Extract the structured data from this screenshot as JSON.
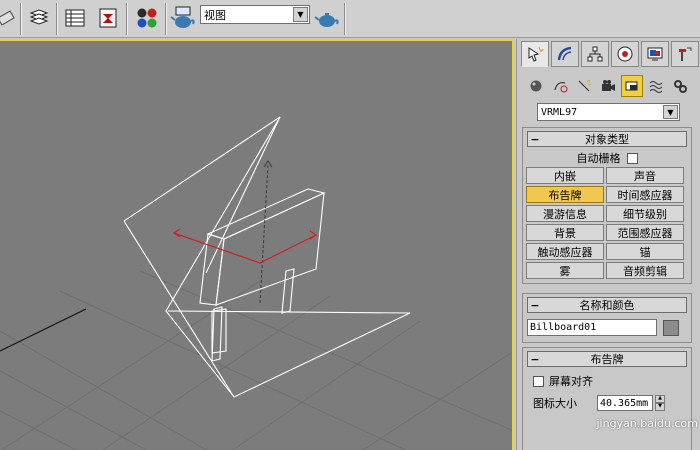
{
  "toolbar": {
    "view_dropdown_value": "视图",
    "icons": [
      "eraser-icon",
      "layers-icon",
      "table-icon",
      "curve-editor-icon",
      "material-editor-icon",
      "render-scene-icon",
      "quick-render-icon",
      "teapot-render-icon"
    ]
  },
  "command_panel": {
    "tabs": [
      "create-tab",
      "modify-tab",
      "hierarchy-tab",
      "motion-tab",
      "display-tab",
      "utilities-tab"
    ],
    "subcategory_dropdown": "VRML97",
    "object_type": {
      "title": "对象类型",
      "auto_grid_label": "自动栅格",
      "buttons": [
        "内嵌",
        "声音",
        "布告牌",
        "时间感应器",
        "漫游信息",
        "细节级别",
        "背景",
        "范围感应器",
        "触动感应器",
        "锚",
        "雾",
        "音频剪辑"
      ],
      "active_button": "布告牌"
    },
    "name_color": {
      "title": "名称和颜色",
      "name_value": "Billboard01",
      "swatch_color": "#8c8c8c"
    },
    "billboard": {
      "title": "布告牌",
      "screen_align_label": "屏幕对齐",
      "icon_size_label": "图标大小",
      "icon_size_value": "40.365mm"
    }
  },
  "viewport": {
    "background_color": "#7c7c7c",
    "active_border_color": "#e8d23a"
  },
  "watermark": "jingyan.baidu.com"
}
